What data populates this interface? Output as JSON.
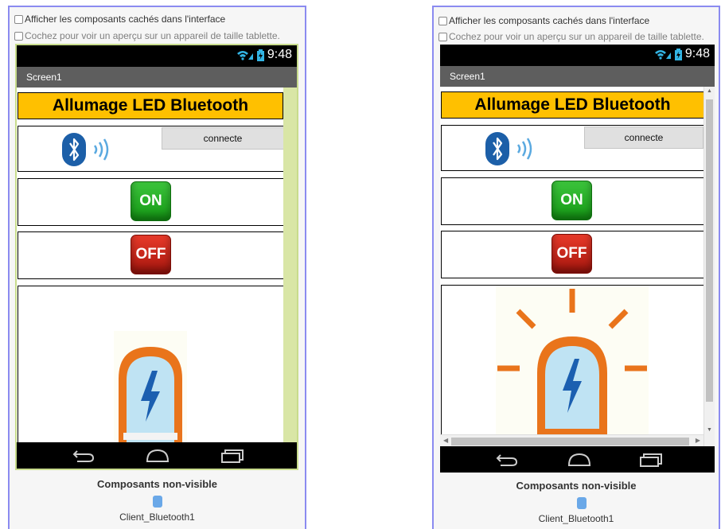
{
  "options": {
    "show_hidden": "Afficher les composants cachés dans l'interface",
    "tablet_preview": "Cochez pour voir un aperçu sur un appareil de taille tablette."
  },
  "status": {
    "time": "9:48"
  },
  "screen_title": "Screen1",
  "app": {
    "banner_text": "Allumage LED Bluetooth",
    "connect_label": "connecte",
    "on_label": "ON",
    "off_label": "OFF"
  },
  "non_visible": {
    "title": "Composants non-visible",
    "component": "Client_Bluetooth1"
  },
  "colors": {
    "banner_bg": "#ffc000",
    "frame_border": "#8b8bf0",
    "on_green": "#1ea81e",
    "off_red": "#c8201a",
    "lamp_orange": "#e9741b",
    "bluetooth_blue": "#1c5fa8"
  }
}
